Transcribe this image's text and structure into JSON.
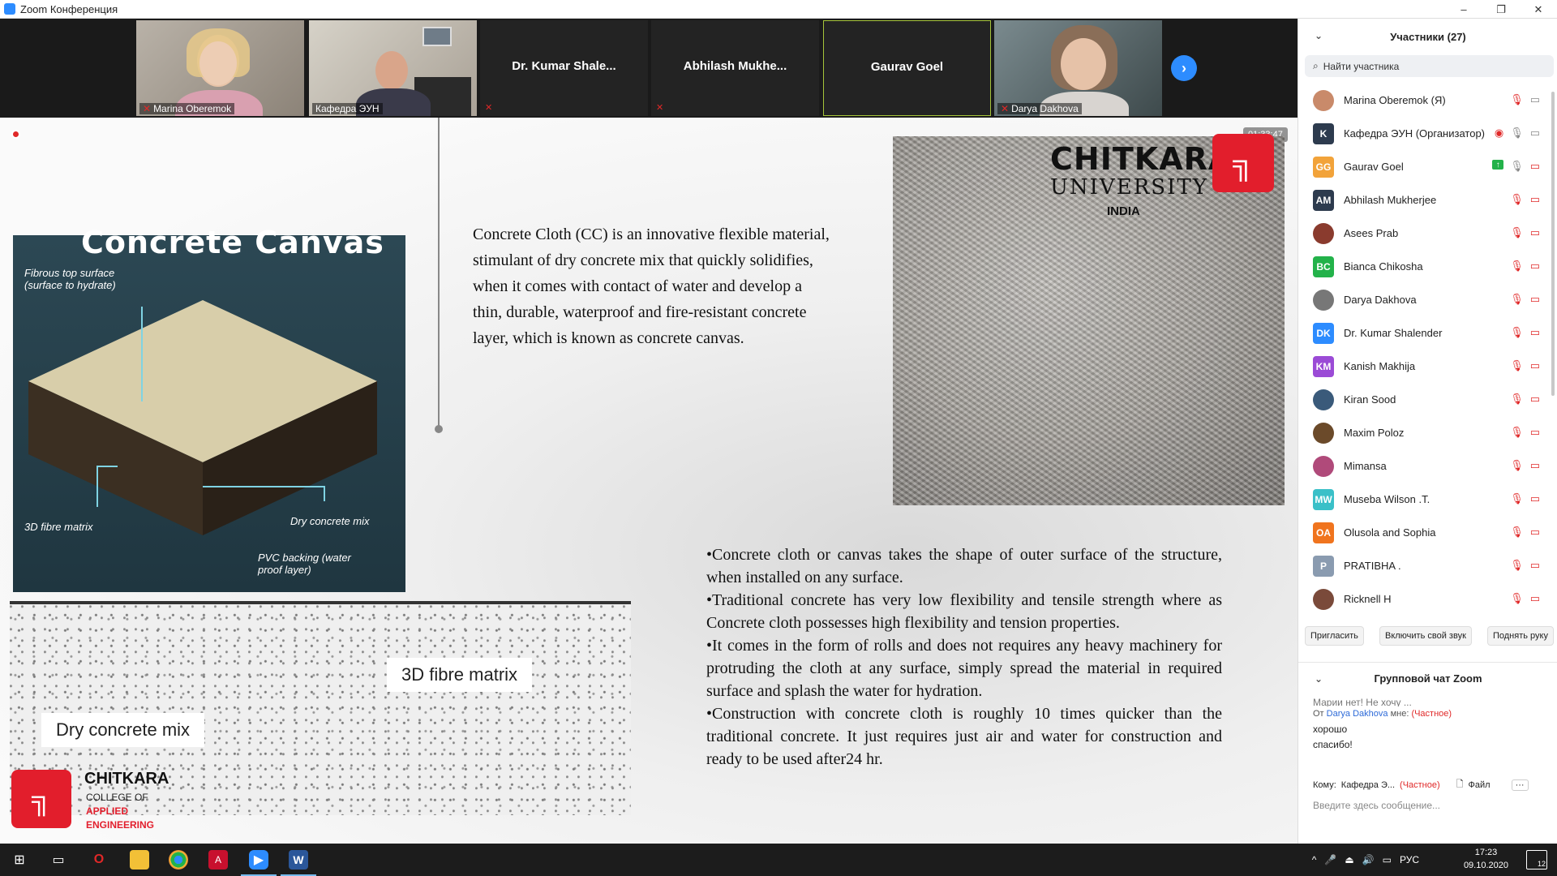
{
  "window": {
    "title": "Zoom Конференция",
    "controls": [
      "–",
      "❐",
      "✕"
    ]
  },
  "video_strip": {
    "tiles": [
      {
        "name": "Marina Oberemok",
        "type": "video",
        "muted": true
      },
      {
        "name": "Кафедра ЭУН",
        "type": "video",
        "muted": false
      },
      {
        "name": "Dr. Kumar Shale...",
        "type": "name",
        "muted": true
      },
      {
        "name": "Abhilash Mukhe...",
        "type": "name",
        "muted": true
      },
      {
        "name": "Gaurav Goel",
        "type": "name",
        "muted": false,
        "active": true
      },
      {
        "name": "Darya Dakhova",
        "type": "video",
        "muted": true
      }
    ],
    "next_icon": "chevron-right-icon"
  },
  "share": {
    "timer": "01:33:47",
    "slide": {
      "left_title": "Concrete Canvas",
      "labels": {
        "fibrous": "Fibrous top surface (surface to hydrate)",
        "fibre_matrix": "3D fibre matrix",
        "dry_mix": "Dry concrete mix",
        "pvc": "PVC backing (water proof layer)"
      },
      "paragraph": "Concrete Cloth (CC) is an innovative flexible material, stimulant of dry concrete mix that quickly solidifies, when it comes with contact of water and develop a thin, durable, waterproof and fire-resistant concrete layer, which is known as concrete canvas.",
      "bullets": [
        "•Concrete cloth or canvas takes the shape of outer surface of the structure, when installed on any surface.",
        "•Traditional concrete has very low flexibility and tensile strength where as Concrete cloth possesses high flexibility and tension properties.",
        "•It comes in the form of rolls and does not requires any heavy machinery   for protruding the cloth at any surface, simply spread the material in required surface and splash the water for hydration.",
        "•Construction with concrete cloth is roughly 10 times quicker than the traditional concrete. It just requires just air and water for construction and ready to be used after24 hr."
      ],
      "box_labels": {
        "fibre_matrix": "3D fibre matrix",
        "dry_mix": "Dry concrete mix"
      },
      "university_logo": {
        "line1": "CHITKARA",
        "line2": "UNIVERSITY",
        "line3": "INDIA"
      },
      "college_logo": {
        "line1": "CHITKARA",
        "line2": "COLLEGE OF",
        "line3": "APPLIED",
        "line4": "ENGINEERING"
      },
      "brand_color": "#e21e2c"
    }
  },
  "participants_panel": {
    "title": "Участники (27)",
    "search_placeholder": "Найти участника",
    "participants": [
      {
        "name": "Marina Oberemok (Я)",
        "avatar": "",
        "color": "#c98a6a",
        "photo": true
      },
      {
        "name": "Кафедра ЭУН (Организатор)",
        "avatar": "K",
        "color": "#2d3b4e"
      },
      {
        "name": "Gaurav Goel",
        "avatar": "GG",
        "color": "#f2a33a"
      },
      {
        "name": "Abhilash Mukherjee",
        "avatar": "AM",
        "color": "#2d3b4e"
      },
      {
        "name": "Asees Prab",
        "avatar": "",
        "color": "#8a3b2e",
        "photo": true
      },
      {
        "name": "Bianca Chikosha",
        "avatar": "BC",
        "color": "#23b24a"
      },
      {
        "name": "Darya Dakhova",
        "avatar": "",
        "color": "#777777",
        "photo": true
      },
      {
        "name": "Dr. Kumar Shalender",
        "avatar": "DK",
        "color": "#2d8cff"
      },
      {
        "name": "Kanish Makhija",
        "avatar": "KM",
        "color": "#9b4bd6"
      },
      {
        "name": "Kiran Sood",
        "avatar": "",
        "color": "#3a5a7a",
        "photo": true
      },
      {
        "name": "Maxim Poloz",
        "avatar": "",
        "color": "#6b4a2a",
        "photo": true
      },
      {
        "name": "Mimansa",
        "avatar": "",
        "color": "#b04a7a",
        "photo": true
      },
      {
        "name": "Museba Wilson .T.",
        "avatar": "MW",
        "color": "#3ac0c8"
      },
      {
        "name": "Olusola and Sophia",
        "avatar": "OA",
        "color": "#f0741e"
      },
      {
        "name": "PRATIBHA .",
        "avatar": "P",
        "color": "#8a9bb0"
      },
      {
        "name": "Ricknell H",
        "avatar": "",
        "color": "#7a4a3a",
        "photo": true
      }
    ],
    "actions": [
      "Пригласить",
      "Включить свой звук",
      "Поднять руку"
    ]
  },
  "chat": {
    "title": "Групповой чат Zoom",
    "cut_line": "Марии нет! Не хочу ...",
    "from_prefix": "От",
    "from_name": "Darya Dakhova",
    "from_suffix": "мне:",
    "private": "(Частное)",
    "messages": [
      "хорошо",
      "спасибо!"
    ],
    "to_label": "Кому:",
    "to_name": "Кафедра Э...",
    "to_private": "(Частное)",
    "file_label": "Файл",
    "more": "···",
    "input_placeholder": "Введите здесь сообщение..."
  },
  "taskbar": {
    "lang": "РУС",
    "time": "17:23",
    "date": "09.10.2020",
    "notifications": "12"
  }
}
